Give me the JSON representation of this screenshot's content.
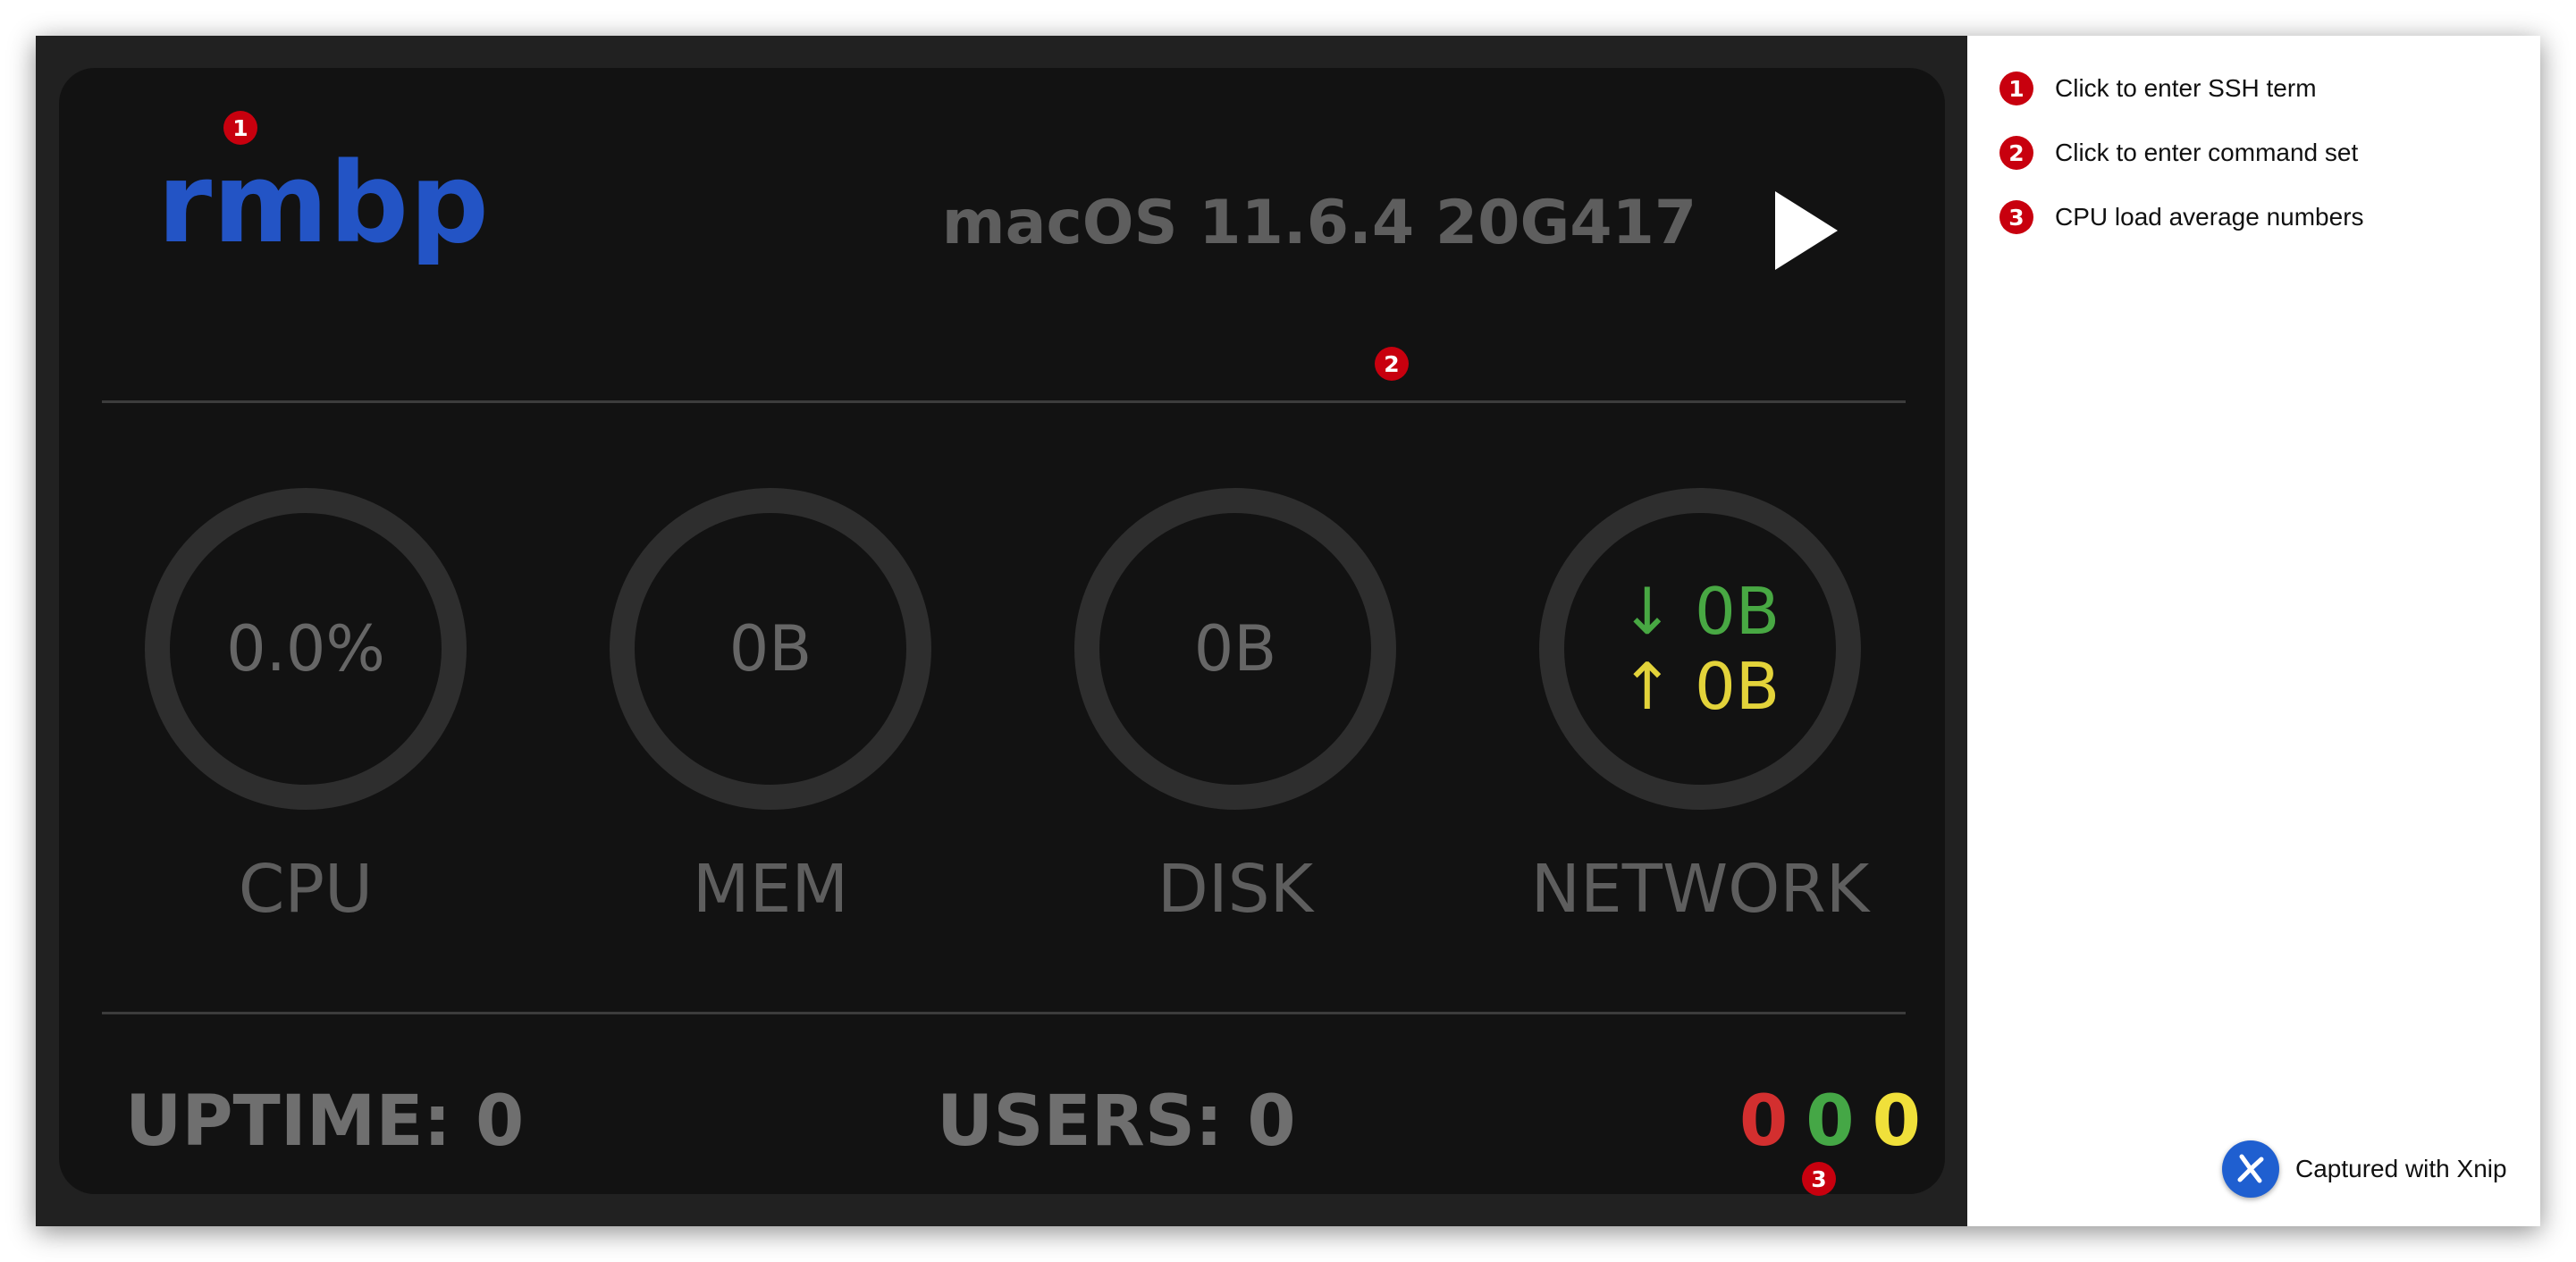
{
  "card": {
    "hostname": "rmbp",
    "os_version": "macOS 11.6.4 20G417",
    "play_icon": "play-icon"
  },
  "gauges": {
    "cpu": {
      "value": "0.0%",
      "label": "CPU"
    },
    "mem": {
      "value": "0B",
      "label": "MEM"
    },
    "disk": {
      "value": "0B",
      "label": "DISK"
    },
    "network": {
      "down_arrow": "↓",
      "down_value": "0B",
      "up_arrow": "↑",
      "up_value": "0B",
      "label": "NETWORK"
    }
  },
  "footer": {
    "uptime": "UPTIME: 0",
    "users": "USERS: 0",
    "load_average": [
      "0",
      "0",
      "0"
    ]
  },
  "colors": {
    "hostname": "#2354c5",
    "network_down": "#48a843",
    "network_up": "#e3d33a",
    "load_1": "#d32f2f",
    "load_5": "#45a746",
    "load_15": "#f0e03a",
    "badge": "#c8000e"
  },
  "annotations": {
    "badges": [
      "1",
      "2",
      "3"
    ],
    "legend": [
      {
        "number": "1",
        "text": "Click to enter SSH term"
      },
      {
        "number": "2",
        "text": "Click to enter command set"
      },
      {
        "number": "3",
        "text": "CPU load average numbers"
      }
    ]
  },
  "watermark": {
    "text": "Captured with Xnip",
    "icon": "xnip-logo-icon"
  }
}
